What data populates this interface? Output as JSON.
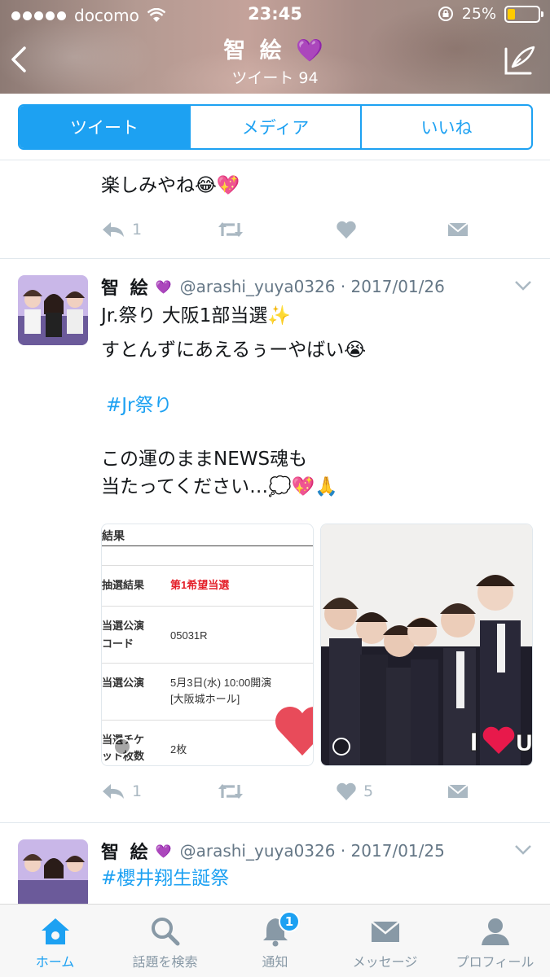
{
  "status_bar": {
    "carrier": "docomo",
    "time": "23:45",
    "battery": "25%",
    "battery_level": 0.25
  },
  "header": {
    "name": "智 絵",
    "tweet_count_label": "ツイート 94"
  },
  "tabs": [
    {
      "label": "ツイート",
      "selected": true
    },
    {
      "label": "メディア",
      "selected": false
    },
    {
      "label": "いいね",
      "selected": false
    }
  ],
  "tweets": [
    {
      "text_lines": [
        "楽しみやね😂💖"
      ],
      "reply_count": "1",
      "like_count": ""
    },
    {
      "author": "智 絵",
      "handle": "@arashi_yuya0326 · 2017/01/26",
      "text_line1": "Jr.祭り 大阪1部当選✨",
      "text_line2": "すとんずにあえるぅーやばい😭",
      "hashtag": "#Jr祭り",
      "text_line3": "この運のままNEWS魂も",
      "text_line4": "当たってください…💭💖🙏",
      "reply_count": "1",
      "like_count": "5",
      "media1": {
        "header": "結果",
        "rows": [
          {
            "label": "抽選結果",
            "value": "第1希望当選"
          },
          {
            "label_line1": "当選公演",
            "label_line2": "コード",
            "value": "05031R"
          },
          {
            "label": "当選公演",
            "value_line1": "5月3日(水) 10:00開演",
            "value_line2": "[大阪城ホール]"
          },
          {
            "label_line1": "当選チケ",
            "label_line2": "ット枚数",
            "value": "2枚"
          }
        ]
      },
      "media2": {
        "overlay_text": "I ❤ U"
      }
    },
    {
      "author": "智 絵",
      "handle": "@arashi_yuya0326 · 2017/01/25",
      "hashtag": "#櫻井翔生誕祭"
    }
  ],
  "tabbar": {
    "items": [
      {
        "label": "ホーム",
        "icon": "home-icon",
        "active": true
      },
      {
        "label": "話題を検索",
        "icon": "search-icon",
        "active": false
      },
      {
        "label": "通知",
        "icon": "bell-icon",
        "active": false,
        "badge": "1"
      },
      {
        "label": "メッセージ",
        "icon": "envelope-icon",
        "active": false
      },
      {
        "label": "プロフィール",
        "icon": "person-icon",
        "active": false
      }
    ]
  },
  "colors": {
    "accent": "#1da1f2",
    "action_gray": "#aab8c2",
    "heart_emoji": "#9b59b6"
  }
}
